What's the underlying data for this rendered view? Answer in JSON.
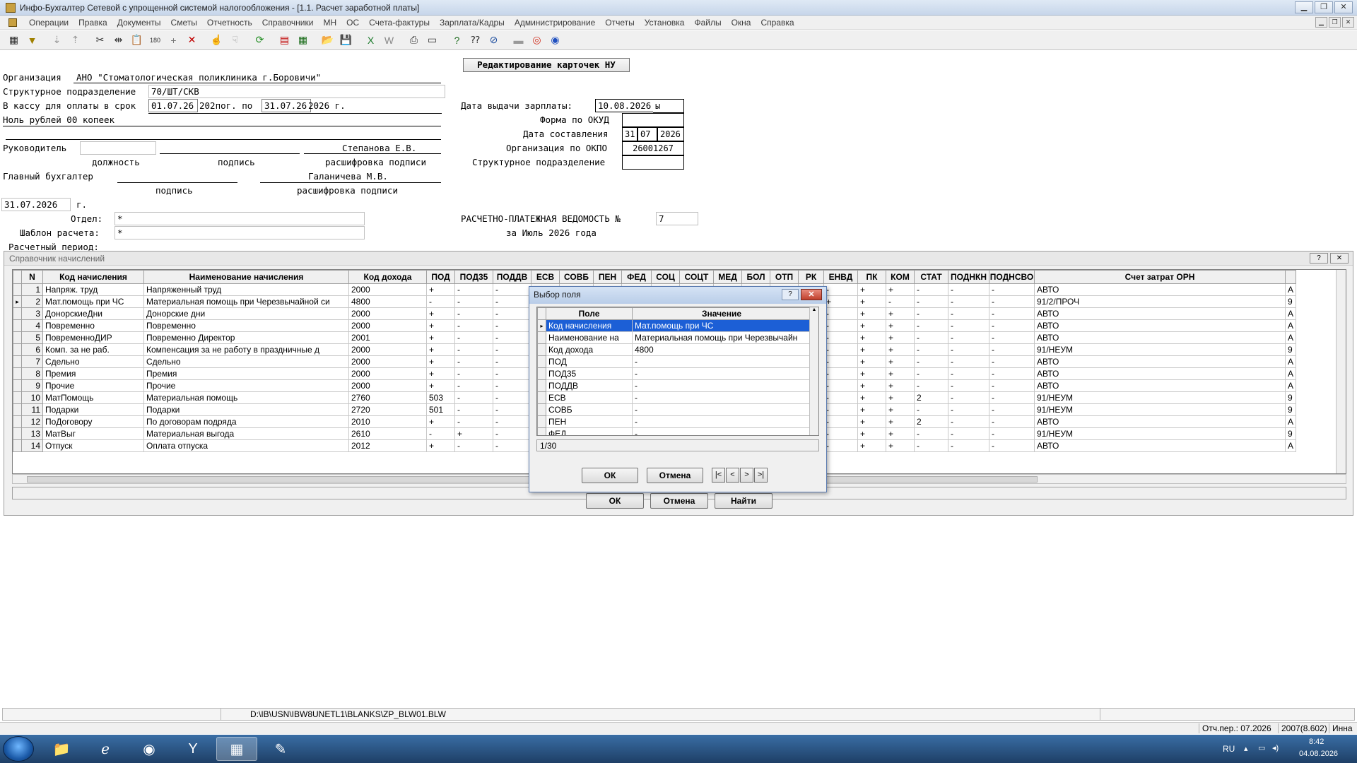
{
  "window": {
    "title": "Инфо-Бухгалтер Сетевой с упрощенной системой налогообложения - [1.1. Расчет заработной платы]"
  },
  "menu": [
    "Операции",
    "Правка",
    "Документы",
    "Сметы",
    "Отчетность",
    "Справочники",
    "МН",
    "ОС",
    "Счета-фактуры",
    "Зарплата/Кадры",
    "Администрирование",
    "Отчеты",
    "Установка",
    "Файлы",
    "Окна",
    "Справка"
  ],
  "toolbar_icons": [
    "table-icon",
    "filter-icon",
    "sort-asc-icon",
    "sort-desc-icon",
    "cut-icon",
    "split-icon",
    "paste-icon",
    "counter-icon",
    "add-icon",
    "delete-icon",
    "pick-icon",
    "pick-all-icon",
    "refresh-icon",
    "pdf-icon",
    "calc-icon",
    "open-icon",
    "save-icon",
    "excel-icon",
    "word-icon",
    "print-icon",
    "preview-icon",
    "help-icon",
    "context-help-icon",
    "compass-icon",
    "hide-icon",
    "lifebuoy-icon",
    "globe-icon"
  ],
  "form": {
    "edit_cards_button": "Редактирование карточек НУ",
    "org_label": "Организация",
    "org_value": "АНО \"Стоматологическая поликлиника г.Боровичи\"",
    "struct_label": "Структурное подразделение",
    "struct_value": "70/ШТ/СКВ",
    "cash_label": "В кассу для оплаты в срок",
    "cash_from": "01.07.26",
    "cash_mid": "202пог. по",
    "cash_to": "31.07.26",
    "cash_year": "2026 г.",
    "amount_words": "Ноль рублей 00 копеек",
    "head_label": "Руководитель",
    "head_name": "Степанова Е.В.",
    "caption_position": "должность",
    "caption_signature": "подпись",
    "caption_decode": "расшифровка подписи",
    "chief_label": "Главный бухгалтер",
    "chief_name": "Галаничева М.В.",
    "caption_signature2": "подпись",
    "caption_decode2": "расшифровка подписи",
    "doc_date": "31.07.2026",
    "doc_date_suffix": "г.",
    "dept_label": "Отдел:",
    "dept_value": "*",
    "template_label": "Шаблон расчета:",
    "template_value": "*",
    "period_label": "Расчетный период:",
    "salary_date_label": "Дата выдачи зарплаты:",
    "salary_date_value": "10.08.2026",
    "salary_date_suffix": "ы",
    "okud_label": "Форма по ОКУД",
    "compose_label": "Дата составления",
    "compose_d": "31",
    "compose_m": "07",
    "compose_y": "2026",
    "okpo_label": "Организация по ОКПО",
    "okpo_value": "26001267",
    "struct2_label": "Структурное подразделение",
    "statement_title": "РАСЧЕТНО-ПЛАТЕЖНАЯ ВЕДОМОСТЬ №",
    "statement_number": "7",
    "statement_period": "за Июль 2026 года"
  },
  "panel": {
    "title": "Справочник начислений",
    "help": "?",
    "close": "✕",
    "ok": "ОК",
    "cancel": "Отмена",
    "find": "Найти"
  },
  "grid": {
    "headers": [
      "N",
      "Код начисления",
      "Наименование начисления",
      "Код дохода",
      "ПОД",
      "ПОД35",
      "ПОДДВ",
      "ЕСВ",
      "СОВБ",
      "ПЕН",
      "ФЕД",
      "СОЦ",
      "СОЦТ",
      "МЕД",
      "БОЛ",
      "ОТП",
      "РК",
      "ЕНВД",
      "ПК",
      "КОМ",
      "СТАТ",
      "ПОДНКН",
      "ПОДНСВО",
      "Счет затрат ОРН",
      ""
    ],
    "rows": [
      [
        "1",
        "Напряж. труд",
        "Напряженный труд",
        "2000",
        "+",
        "-",
        "-",
        "",
        "",
        "",
        "",
        "",
        "",
        "",
        "",
        "",
        "",
        "-",
        "+",
        "+",
        "-",
        "-",
        "-",
        "АВТО",
        "А"
      ],
      [
        "2",
        "Мат.помощь при ЧС",
        "Материальная помощь при Черезвычайной си",
        "4800",
        "-",
        "-",
        "-",
        "",
        "",
        "",
        "",
        "",
        "",
        "",
        "",
        "",
        "",
        "+",
        "+",
        "-",
        "-",
        "-",
        "-",
        "91/2/ПРОЧ",
        "9"
      ],
      [
        "3",
        "ДонорскиеДни",
        "Донорские дни",
        "2000",
        "+",
        "-",
        "-",
        "",
        "",
        "",
        "",
        "",
        "",
        "",
        "",
        "",
        "",
        "-",
        "+",
        "+",
        "-",
        "-",
        "-",
        "АВТО",
        "А"
      ],
      [
        "4",
        "Повременно",
        "Повременно",
        "2000",
        "+",
        "-",
        "-",
        "",
        "",
        "",
        "",
        "",
        "",
        "",
        "",
        "",
        "",
        "-",
        "+",
        "+",
        "-",
        "-",
        "-",
        "АВТО",
        "А"
      ],
      [
        "5",
        "ПовременноДИР",
        "Повременно Директор",
        "2001",
        "+",
        "-",
        "-",
        "",
        "",
        "",
        "",
        "",
        "",
        "",
        "",
        "",
        "",
        "-",
        "+",
        "+",
        "-",
        "-",
        "-",
        "АВТО",
        "А"
      ],
      [
        "6",
        "Комп. за не раб.",
        "Компенсация за не работу в праздничные д",
        "2000",
        "+",
        "-",
        "-",
        "",
        "",
        "",
        "",
        "",
        "",
        "",
        "",
        "",
        "",
        "-",
        "+",
        "+",
        "-",
        "-",
        "-",
        "91/НЕУМ",
        "9"
      ],
      [
        "7",
        "Сдельно",
        "Сдельно",
        "2000",
        "+",
        "-",
        "-",
        "",
        "",
        "",
        "",
        "",
        "",
        "",
        "",
        "",
        "",
        "-",
        "+",
        "+",
        "-",
        "-",
        "-",
        "АВТО",
        "А"
      ],
      [
        "8",
        "Премия",
        "Премия",
        "2000",
        "+",
        "-",
        "-",
        "",
        "",
        "",
        "",
        "",
        "",
        "",
        "",
        "",
        "",
        "-",
        "+",
        "+",
        "-",
        "-",
        "-",
        "АВТО",
        "А"
      ],
      [
        "9",
        "Прочие",
        "Прочие",
        "2000",
        "+",
        "-",
        "-",
        "",
        "",
        "",
        "",
        "",
        "",
        "",
        "",
        "",
        "",
        "-",
        "+",
        "+",
        "-",
        "-",
        "-",
        "АВТО",
        "А"
      ],
      [
        "10",
        "МатПомощь",
        "Материальная помощь",
        "2760",
        "503",
        "-",
        "-",
        "",
        "",
        "",
        "",
        "",
        "",
        "",
        "",
        "",
        "",
        "-",
        "+",
        "+",
        "2",
        "-",
        "-",
        "91/НЕУМ",
        "9"
      ],
      [
        "11",
        "Подарки",
        "Подарки",
        "2720",
        "501",
        "-",
        "-",
        "",
        "",
        "",
        "",
        "",
        "",
        "",
        "",
        "",
        "",
        "-",
        "+",
        "+",
        "-",
        "-",
        "-",
        "91/НЕУМ",
        "9"
      ],
      [
        "12",
        "ПоДоговору",
        "По договорам подряда",
        "2010",
        "+",
        "-",
        "-",
        "",
        "",
        "",
        "",
        "",
        "",
        "",
        "",
        "",
        "",
        "-",
        "+",
        "+",
        "2",
        "-",
        "-",
        "АВТО",
        "А"
      ],
      [
        "13",
        "МатВыг",
        "Материальная выгода",
        "2610",
        "-",
        "+",
        "-",
        "",
        "",
        "",
        "",
        "",
        "",
        "",
        "",
        "",
        "",
        "-",
        "+",
        "+",
        "-",
        "-",
        "-",
        "91/НЕУМ",
        "9"
      ],
      [
        "14",
        "Отпуск",
        "Оплата отпуска",
        "2012",
        "+",
        "-",
        "-",
        "",
        "",
        "",
        "",
        "",
        "",
        "",
        "",
        "",
        "",
        "-",
        "+",
        "+",
        "-",
        "-",
        "-",
        "АВТО",
        "А"
      ]
    ],
    "selected_row": 1,
    "row_marker": "▸"
  },
  "dialog": {
    "title": "Выбор поля",
    "help": "?",
    "close": "✕",
    "col_field": "Поле",
    "col_value": "Значение",
    "rows": [
      [
        "Код начисления",
        "Мат.помощь при ЧС"
      ],
      [
        "Наименование на",
        "Материальная помощь при Черезвычайн"
      ],
      [
        "Код дохода",
        "4800"
      ],
      [
        "ПОД",
        "-"
      ],
      [
        "ПОД35",
        "-"
      ],
      [
        "ПОДДВ",
        "-"
      ],
      [
        "ЕСВ",
        "-"
      ],
      [
        "СОВБ",
        "-"
      ],
      [
        "ПЕН",
        "-"
      ],
      [
        "ФЕД",
        "-"
      ]
    ],
    "active_row": 0,
    "counter": "1/30",
    "ok": "ОК",
    "cancel": "Отмена",
    "nav_first": "|<",
    "nav_prev": "<",
    "nav_next": ">",
    "nav_last": ">|"
  },
  "statusbar": {
    "path": "D:\\IB\\USN\\IBW8UNETL1\\BLANKS\\ZP_BLW01.BLW",
    "period": "Отч.пер.: 07.2026",
    "version": "2007(8.602)",
    "user": "Инна"
  },
  "taskbar": {
    "lang": "RU",
    "time": "8:42",
    "date": "04.08.2026",
    "apps": [
      "explorer-icon",
      "ie-icon",
      "chrome-icon",
      "yandex-icon",
      "infobuh-icon",
      "paint-icon"
    ]
  }
}
